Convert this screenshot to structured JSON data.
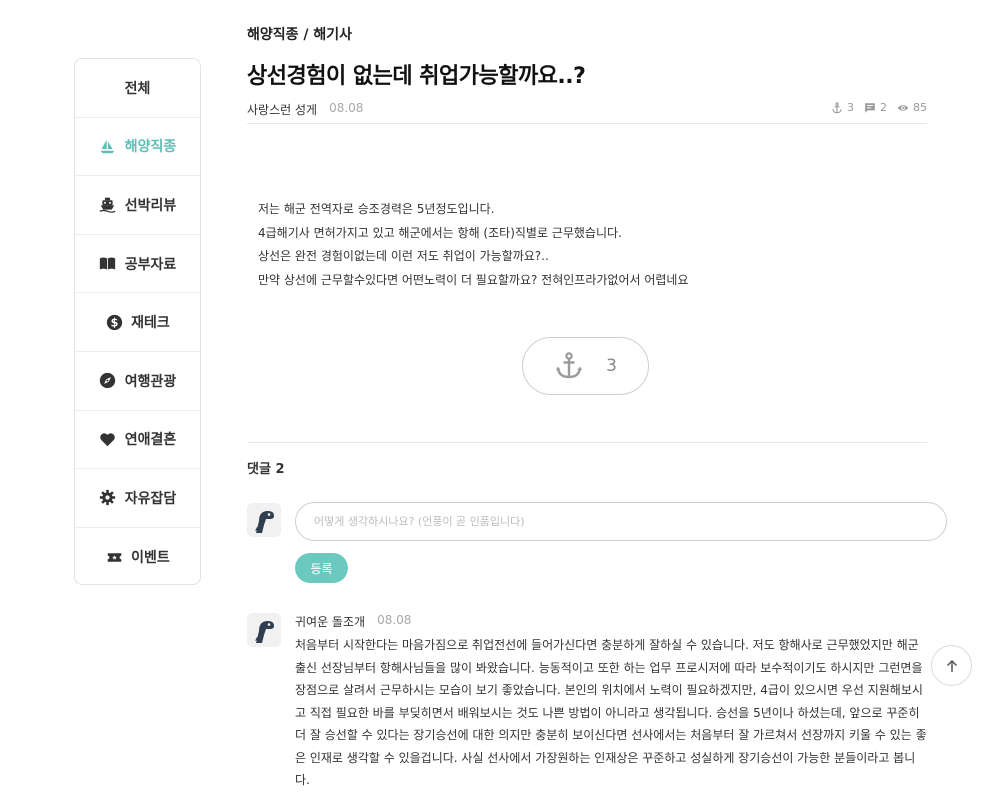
{
  "sidebar": {
    "items": [
      {
        "label": "전체",
        "icon": "none"
      },
      {
        "label": "해양직종",
        "icon": "sailboat-icon",
        "active": true
      },
      {
        "label": "선박리뷰",
        "icon": "ship-icon"
      },
      {
        "label": "공부자료",
        "icon": "book-icon"
      },
      {
        "label": "재테크",
        "icon": "dollar-icon"
      },
      {
        "label": "여행관광",
        "icon": "compass-icon"
      },
      {
        "label": "연애결혼",
        "icon": "heart-icon"
      },
      {
        "label": "자유잡담",
        "icon": "gear-icon"
      },
      {
        "label": "이벤트",
        "icon": "ticket-icon"
      }
    ],
    "accent": "#5cc0b5"
  },
  "post": {
    "breadcrumb": "해양직종 / 해기사",
    "title": "상선경험이 없는데 취업가능할까요..?",
    "author": "사랑스런 성게",
    "date": "08.08",
    "stats": {
      "anchors": "3",
      "comments": "2",
      "views": "85"
    },
    "body": [
      "저는 해군 전역자로 승조경력은 5년정도입니다.",
      "4급해기사 면허가지고 있고 해군에서는 항해 (조타)직별로 근무했습니다.",
      "상선은 완전 경험이없는데 이런 저도 취업이 가능할까요?..",
      "만약 상선에 근무할수있다면 어떤노력이 더 필요할까요? 전혀인프라가없어서 어렵네요"
    ],
    "anchor_count": "3"
  },
  "comments": {
    "header": "댓글 2",
    "input_placeholder": "어떻게 생각하시나요? (언풍이 곧 인품입니다)",
    "submit_label": "등록",
    "items": [
      {
        "author": "귀여운 돌조개",
        "date": "08.08",
        "text": "처음부터 시작한다는 마음가짐으로 취업전선에 들어가신다면 충분하게 잘하실 수 있습니다. 저도 항해사로 근무했었지만 해군출신 선장님부터 항해사님들을 많이 봐왔습니다. 능동적이고 또한 하는 업무 프로시저에 따라 보수적이기도 하시지만 그런면을 장점으로 살려서 근무하시는 모습이 보기 좋았습니다. 본인의 위치에서 노력이 필요하겠지만, 4급이 있으시면 우선 지원해보시고 직접 필요한 바를 부딪히면서 배워보시는 것도 나쁜 방법이 아니라고 생각됩니다. 승선을 5년이나 하셨는데, 앞으로 꾸준히 더 잘 승선할 수 있다는 장기승선에 대한 의지만 충분히 보이신다면 선사에서는 처음부터 잘 가르쳐서 선장까지 키울 수 있는 좋은 인재로 생각할 수 있을겁니다. 사실 선사에서 가장원하는 인재상은 꾸준하고 성실하게 장기승선이 가능한 분들이라고 봅니다."
      }
    ]
  }
}
